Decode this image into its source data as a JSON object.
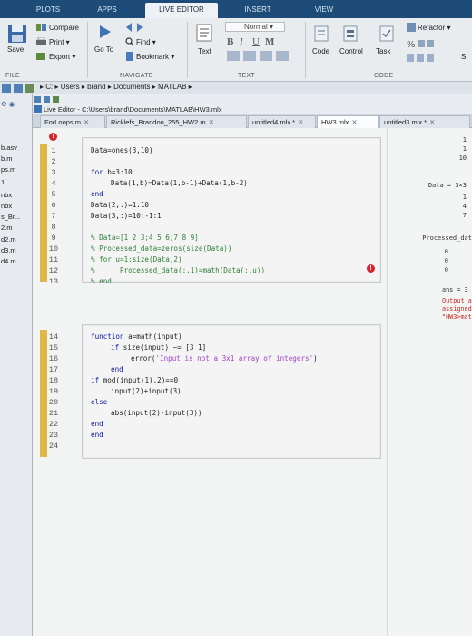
{
  "ribbon": {
    "tabs": [
      "PLOTS",
      "APPS",
      "LIVE EDITOR",
      "INSERT",
      "VIEW"
    ],
    "active_tab": "LIVE EDITOR"
  },
  "toolstrip": {
    "file_section": {
      "label": "FILE",
      "save_label": "Save",
      "compare_label": "Compare",
      "print_label": "Print",
      "export_label": "Export"
    },
    "navigate_section": {
      "label": "NAVIGATE",
      "goto_label": "Go To",
      "find_label": "Find",
      "bookmark_label": "Bookmark"
    },
    "text_section": {
      "label": "TEXT",
      "text_label": "Text",
      "style_value": "Normal",
      "bold": "B",
      "italic": "I",
      "underline": "U",
      "monospace": "M"
    },
    "code_section": {
      "label": "CODE",
      "code_label": "Code",
      "control_label": "Control",
      "task_label": "Task",
      "refactor_label": "Refactor",
      "s_label": "S"
    }
  },
  "path_bar": {
    "segments": [
      "C:",
      "Users",
      "brand",
      "Documents",
      "MATLAB"
    ]
  },
  "left_panel": {
    "files": [
      "b.asv",
      "b.m",
      "ps.m",
      "1",
      "nbx",
      "nbx",
      "s_Br...",
      "2.m",
      "d2.m",
      "d3.m",
      "d4.m"
    ]
  },
  "editor": {
    "title": "Live Editor - C:\\Users\\brand\\Documents\\MATLAB\\HW3.mlx",
    "tabs": [
      {
        "label": "ForLoops.m",
        "active": false
      },
      {
        "label": "Ricklefs_Brandon_255_HW2.m",
        "active": false
      },
      {
        "label": "untitled4.mlx *",
        "active": false
      },
      {
        "label": "HW3.mlx",
        "active": true
      },
      {
        "label": "untitled3.mlx *",
        "active": false
      }
    ],
    "line_numbers": [
      "1",
      "2",
      "3",
      "4",
      "5",
      "6",
      "7",
      "8",
      "9",
      "10",
      "11",
      "12",
      "13",
      "14",
      "15",
      "16",
      "17",
      "18",
      "19",
      "20",
      "21",
      "22",
      "23",
      "24"
    ],
    "code": {
      "l1": "Data=ones(3,10)",
      "l3_kw": "for",
      "l3_rest": " b=3:10",
      "l4": "Data(1,b)=Data(1,b-1)+Data(1,b-2)",
      "l5_kw": "end",
      "l6": "Data(2,:)=1:10",
      "l7": "Data(3,:)=10:-1:1",
      "l9": "% Data=[1 2 3;4 5 6;7 8 9]",
      "l10": "% Processed_data=zeros(size(Data))",
      "l11": "% for u=1:size(Data,2)",
      "l12": "%      Processed_data(:,1)=math(Data(:,u))",
      "l13": "% end",
      "l14_kw": "function",
      "l14_rest": " a=math(input)",
      "l15_kw": "if",
      "l15_rest": " size(input) ~= [3 1]",
      "l16_pre": "error(",
      "l16_str": "'Input is not a 3x1 array of integers'",
      "l16_post": ")",
      "l17_kw": "end",
      "l18_kw": "if",
      "l18_rest": " mod(input(1),2)==0",
      "l19": "input(2)+input(3)",
      "l20_kw": "else",
      "l21": "abs(input(2)-input(3))",
      "l22_kw": "end",
      "l23_kw": "end"
    }
  },
  "output": {
    "top_values": [
      "1",
      "1",
      "10"
    ],
    "data_label": "Data = 3×3",
    "data_values": [
      "1",
      "4",
      "7"
    ],
    "processed_label": "Processed_dat",
    "processed_values": [
      "0",
      "0",
      "0"
    ],
    "ans_text": "ans = 3",
    "error_lines": [
      "Output argume",
      "assigned a va",
      "\"HW3>math\" fu"
    ]
  },
  "error_glyph": "!",
  "colors": {
    "ribbon_blue": "#1d4c79",
    "keyword_blue": "#0a1aa8",
    "comment_green": "#2f7f38",
    "string_purple": "#a23ec9",
    "error_red": "#d8232a"
  }
}
